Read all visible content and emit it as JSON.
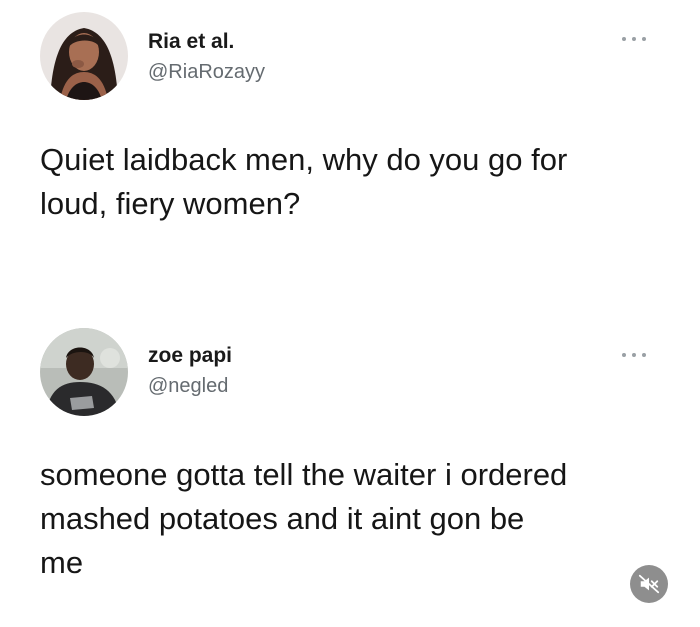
{
  "tweets": [
    {
      "display_name": "Ria et al.",
      "handle": "@RiaRozayy",
      "text": "Quiet laidback men, why do you go for\nloud, fiery women?",
      "avatar_icon": "profile-photo-woman",
      "more_icon": "ellipsis-icon"
    },
    {
      "display_name": "zoe papi",
      "handle": "@negled",
      "text": "someone gotta tell the waiter i ordered\nmashed potatoes and it aint gon be\nme",
      "avatar_icon": "profile-photo-man",
      "more_icon": "ellipsis-icon"
    }
  ],
  "overlay": {
    "mute_icon": "speaker-muted-icon"
  },
  "colors": {
    "text": "#161616",
    "handle": "#656b70",
    "dots": "#9aa0a5",
    "mute_bg": "#8e8e8e"
  }
}
